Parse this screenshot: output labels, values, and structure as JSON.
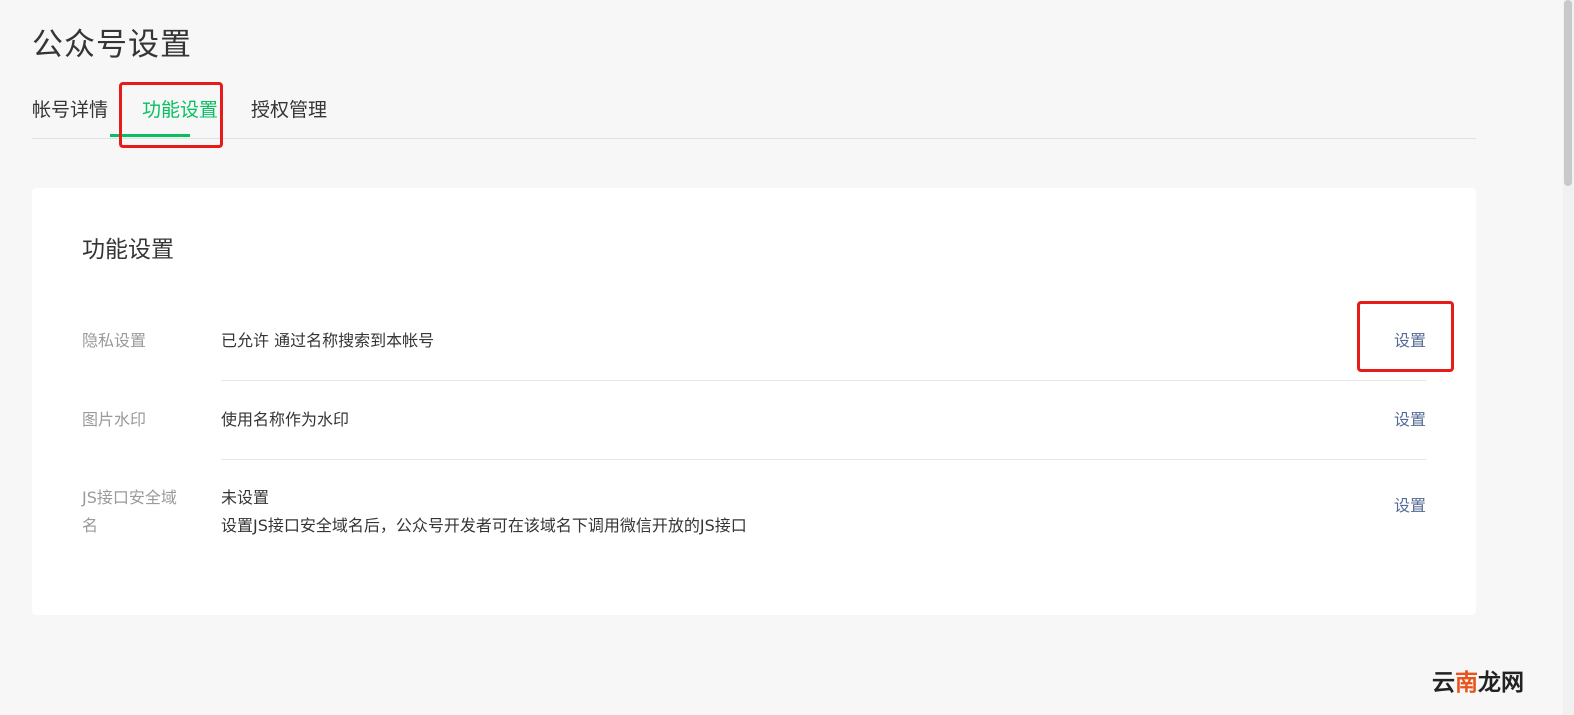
{
  "page": {
    "title": "公众号设置"
  },
  "tabs": [
    {
      "label": "帐号详情",
      "active": false
    },
    {
      "label": "功能设置",
      "active": true
    },
    {
      "label": "授权管理",
      "active": false
    }
  ],
  "card": {
    "title": "功能设置",
    "rows": [
      {
        "label": "隐私设置",
        "value": "已允许 通过名称搜索到本帐号",
        "action": "设置"
      },
      {
        "label": "图片水印",
        "value": "使用名称作为水印",
        "action": "设置"
      },
      {
        "label_line1": "JS接口安全域",
        "label_line2": "名",
        "value_line1": "未设置",
        "value_line2": "设置JS接口安全域名后，公众号开发者可在该域名下调用微信开放的JS接口",
        "action": "设置"
      }
    ]
  },
  "watermark": {
    "part1": "云",
    "part2": "南",
    "part3": "龙网"
  },
  "colors": {
    "accent": "#07c160",
    "link": "#576b95",
    "highlight": "#e81a1a"
  }
}
